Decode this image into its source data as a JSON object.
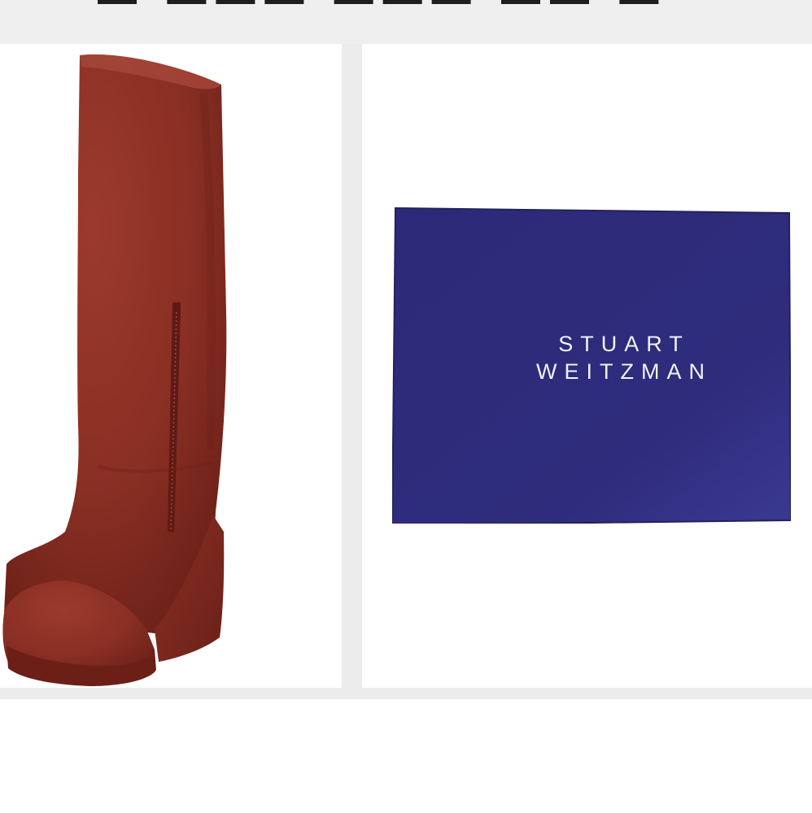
{
  "box_logo": {
    "line1": "STUART",
    "line2": "WEITZMAN"
  },
  "colors": {
    "boot_suede": "#8e3226",
    "box_blue": "#2e2b7a",
    "page_background": "#ececec",
    "tile_background": "#ffffff"
  },
  "icons": {
    "boot": "suede-wedge-knee-boot-photo",
    "box": "shoe-box-lid-photo"
  }
}
